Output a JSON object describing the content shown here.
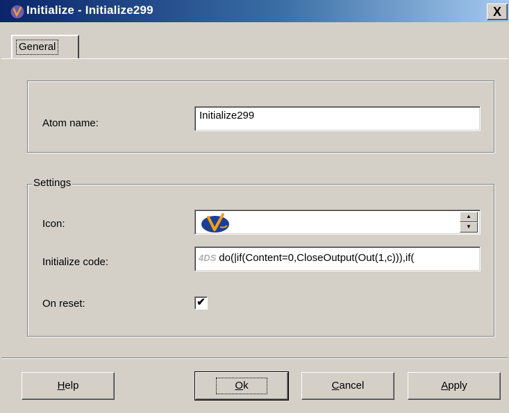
{
  "window": {
    "title": "Initialize - Initialize299",
    "close_label": "X"
  },
  "tabs": [
    {
      "label": "General",
      "selected": true
    }
  ],
  "general": {
    "atom_name_label": "Atom name:",
    "atom_name_value": "Initialize299"
  },
  "settings": {
    "group_title": "Settings",
    "icon_label": "Icon:",
    "icon_name": "initialize-atom-icon",
    "code_label": "Initialize code:",
    "code_prefix": "4DS",
    "code_value": "do(|if(Content=0,CloseOutput(Out(1,c))),if(",
    "reset_label": "On reset:",
    "reset_checked": true,
    "check_mark": "✔"
  },
  "buttons": {
    "help": {
      "first": "H",
      "rest": "elp"
    },
    "ok": {
      "first": "O",
      "rest": "k"
    },
    "cancel": {
      "first": "C",
      "rest": "ancel"
    },
    "apply": {
      "first": "A",
      "rest": "pply"
    }
  },
  "colors": {
    "titlebar_start": "#0a246a",
    "titlebar_end": "#a6caf0",
    "face": "#d4d0c8",
    "icon_blue": "#1c3f95",
    "icon_orange": "#f0a020"
  }
}
